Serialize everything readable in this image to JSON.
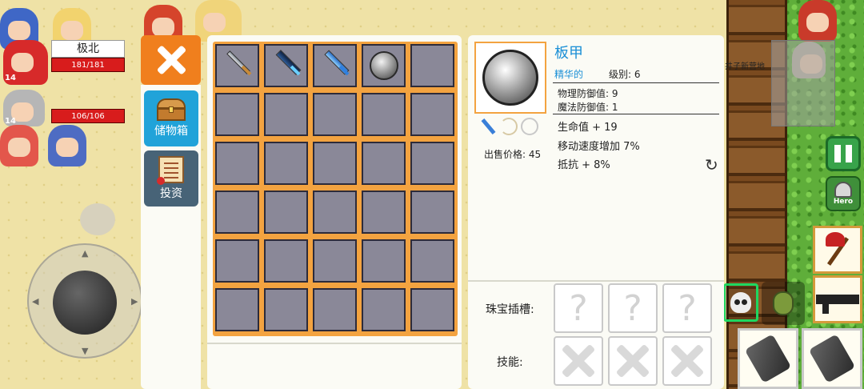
{
  "hud": {
    "player_name": "极北",
    "party": [
      {
        "level": "14",
        "hp": "181/181"
      },
      {
        "level": "14",
        "hp": "106/106"
      }
    ],
    "map_label": "井子新营地",
    "hero_button_label": "Hero"
  },
  "nav": {
    "storage_label": "储物箱",
    "invest_label": "投资"
  },
  "inventory": {
    "rows": 6,
    "cols": 5,
    "items": [
      {
        "slot": 0,
        "icon": "steel-sword-icon"
      },
      {
        "slot": 1,
        "icon": "dark-greatsword-icon"
      },
      {
        "slot": 2,
        "icon": "blue-sword-icon"
      },
      {
        "slot": 3,
        "icon": "plate-armor-icon"
      }
    ]
  },
  "detail": {
    "name": "板甲",
    "rarity": "精华的",
    "level": "级别: 6",
    "phys_def": "物理防御值: 9",
    "mag_def": "魔法防御值: 1",
    "bonuses": [
      "生命值 + 19",
      "移动速度增加 7%",
      "抵抗 + 8%"
    ],
    "sell_price": "出售价格: 45",
    "gem_label": "珠宝插槽:",
    "gem_slots": [
      "?",
      "?",
      "?"
    ],
    "skill_label": "技能:",
    "skill_slots": 3,
    "class_icons": [
      "sword-class-icon",
      "bow-class-icon",
      "staff-class-icon"
    ]
  },
  "colors": {
    "accent_orange": "#f07f1d",
    "storage_tab": "#21a3d9",
    "invest_tab": "#476377",
    "grid_frame": "#f3a340",
    "cell": "#8a8898",
    "rarity_blue": "#1a8fd6"
  }
}
